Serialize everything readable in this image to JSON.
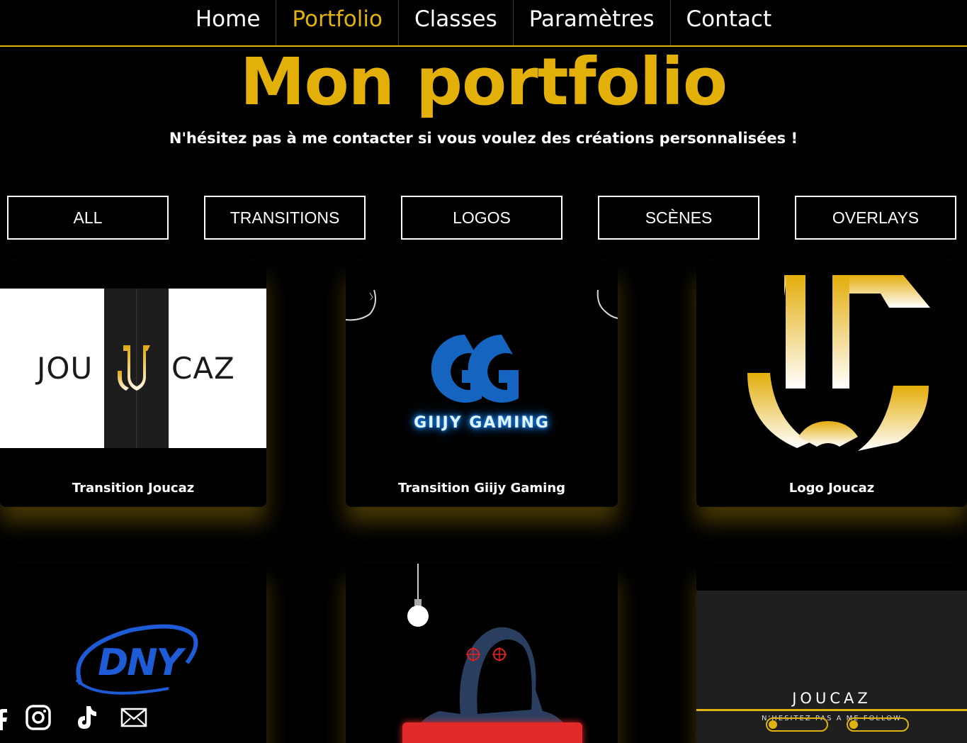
{
  "nav": {
    "items": [
      {
        "label": "Home",
        "active": false
      },
      {
        "label": "Portfolio",
        "active": true
      },
      {
        "label": "Classes",
        "active": false
      },
      {
        "label": "Paramètres",
        "active": false
      },
      {
        "label": "Contact",
        "active": false
      }
    ]
  },
  "header": {
    "title": "Mon portfolio",
    "subtitle": "N'hésitez pas à me contacter si vous voulez des créations personnalisées !"
  },
  "filters": [
    "ALL",
    "TRANSITIONS",
    "LOGOS",
    "SCÈNES",
    "OVERLAYS"
  ],
  "cards": [
    {
      "label": "Transition Joucaz",
      "thumb_left_text": "JOU",
      "thumb_right_text": "CAZ"
    },
    {
      "label": "Transition Giijy Gaming",
      "thumb_text": "GIIJY GAMING"
    },
    {
      "label": "Logo Joucaz"
    },
    {
      "thumb_text": "DNY"
    },
    {},
    {
      "overlay_name": "JOUCAZ",
      "overlay_sub": "N'HESITEZ PAS A ME FOLLOW",
      "bars": [
        0.15,
        0.15
      ]
    }
  ],
  "social": [
    "facebook-icon",
    "instagram-icon",
    "tiktok-icon",
    "mail-icon"
  ],
  "colors": {
    "accent": "#e0b20e",
    "background": "#000000",
    "text": "#ffffff",
    "giijy_blue": "#1565c0",
    "dny_blue": "#1e5bd6"
  }
}
